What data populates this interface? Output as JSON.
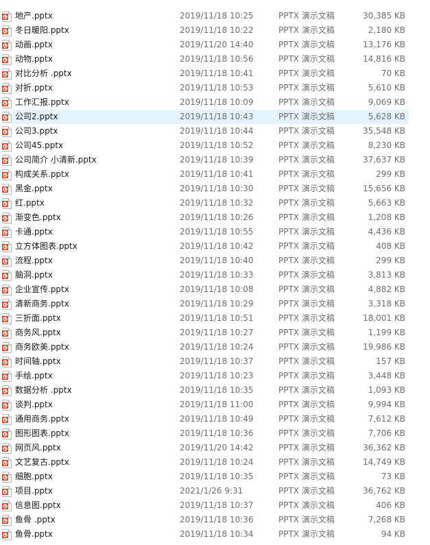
{
  "files": [
    {
      "name": "地产.pptx",
      "date": "2019/11/18 10:25",
      "type": "PPTX 演示文稿",
      "size": "30,385 KB",
      "selected": false
    },
    {
      "name": "冬日暖阳.pptx",
      "date": "2019/11/18 10:22",
      "type": "PPTX 演示文稿",
      "size": "2,180 KB",
      "selected": false
    },
    {
      "name": "动画.pptx",
      "date": "2019/11/20 14:40",
      "type": "PPTX 演示文稿",
      "size": "13,176 KB",
      "selected": false
    },
    {
      "name": "动物.pptx",
      "date": "2019/11/18 10:56",
      "type": "PPTX 演示文稿",
      "size": "14,816 KB",
      "selected": false
    },
    {
      "name": "对比分析 .pptx",
      "date": "2019/11/18 10:41",
      "type": "PPTX 演示文稿",
      "size": "70 KB",
      "selected": false
    },
    {
      "name": "对折.pptx",
      "date": "2019/11/18 10:53",
      "type": "PPTX 演示文稿",
      "size": "5,610 KB",
      "selected": false
    },
    {
      "name": "工作汇报.pptx",
      "date": "2019/11/18 10:09",
      "type": "PPTX 演示文稿",
      "size": "9,069 KB",
      "selected": false
    },
    {
      "name": "公司2.pptx",
      "date": "2019/11/18 10:43",
      "type": "PPTX 演示文稿",
      "size": "5,628 KB",
      "selected": true
    },
    {
      "name": "公司3.pptx",
      "date": "2019/11/18 10:44",
      "type": "PPTX 演示文稿",
      "size": "35,548 KB",
      "selected": false
    },
    {
      "name": "公司45.pptx",
      "date": "2019/11/18 10:52",
      "type": "PPTX 演示文稿",
      "size": "8,230 KB",
      "selected": false
    },
    {
      "name": "公司简介 小清新.pptx",
      "date": "2019/11/18 10:39",
      "type": "PPTX 演示文稿",
      "size": "37,637 KB",
      "selected": false
    },
    {
      "name": "构成关系.pptx",
      "date": "2019/11/18 10:41",
      "type": "PPTX 演示文稿",
      "size": "299 KB",
      "selected": false
    },
    {
      "name": "黑金.pptx",
      "date": "2019/11/18 10:30",
      "type": "PPTX 演示文稿",
      "size": "15,656 KB",
      "selected": false
    },
    {
      "name": "红.pptx",
      "date": "2019/11/18 10:32",
      "type": "PPTX 演示文稿",
      "size": "5,663 KB",
      "selected": false
    },
    {
      "name": "渐变色.pptx",
      "date": "2019/11/18 10:26",
      "type": "PPTX 演示文稿",
      "size": "1,208 KB",
      "selected": false
    },
    {
      "name": "卡通.pptx",
      "date": "2019/11/18 10:55",
      "type": "PPTX 演示文稿",
      "size": "4,436 KB",
      "selected": false
    },
    {
      "name": "立方体图表.pptx",
      "date": "2019/11/18 10:42",
      "type": "PPTX 演示文稿",
      "size": "408 KB",
      "selected": false
    },
    {
      "name": "流程.pptx",
      "date": "2019/11/18 10:40",
      "type": "PPTX 演示文稿",
      "size": "299 KB",
      "selected": false
    },
    {
      "name": "脑洞.pptx",
      "date": "2019/11/18 10:33",
      "type": "PPTX 演示文稿",
      "size": "3,813 KB",
      "selected": false
    },
    {
      "name": "企业宣传.pptx",
      "date": "2019/11/18 10:08",
      "type": "PPTX 演示文稿",
      "size": "4,882 KB",
      "selected": false
    },
    {
      "name": "清新商务.pptx",
      "date": "2019/11/18 10:29",
      "type": "PPTX 演示文稿",
      "size": "3,318 KB",
      "selected": false
    },
    {
      "name": "三折面.pptx",
      "date": "2019/11/18 10:51",
      "type": "PPTX 演示文稿",
      "size": "18,001 KB",
      "selected": false
    },
    {
      "name": "商务风.pptx",
      "date": "2019/11/18 10:27",
      "type": "PPTX 演示文稿",
      "size": "1,199 KB",
      "selected": false
    },
    {
      "name": "商务欧美.pptx",
      "date": "2019/11/18 10:24",
      "type": "PPTX 演示文稿",
      "size": "19,986 KB",
      "selected": false
    },
    {
      "name": "时间轴.pptx",
      "date": "2019/11/18 10:37",
      "type": "PPTX 演示文稿",
      "size": "157 KB",
      "selected": false
    },
    {
      "name": "手绘.pptx",
      "date": "2019/11/18 10:23",
      "type": "PPTX 演示文稿",
      "size": "3,448 KB",
      "selected": false
    },
    {
      "name": "数据分析 .pptx",
      "date": "2019/11/18 10:35",
      "type": "PPTX 演示文稿",
      "size": "1,093 KB",
      "selected": false
    },
    {
      "name": "谈判.pptx",
      "date": "2019/11/18 11:00",
      "type": "PPTX 演示文稿",
      "size": "9,994 KB",
      "selected": false
    },
    {
      "name": "通用商务.pptx",
      "date": "2019/11/18 10:49",
      "type": "PPTX 演示文稿",
      "size": "7,612 KB",
      "selected": false
    },
    {
      "name": "图形图表.pptx",
      "date": "2019/11/18 10:36",
      "type": "PPTX 演示文稿",
      "size": "7,706 KB",
      "selected": false
    },
    {
      "name": "网页风.pptx",
      "date": "2019/11/20 14:42",
      "type": "PPTX 演示文稿",
      "size": "36,362 KB",
      "selected": false
    },
    {
      "name": "文艺复古.pptx",
      "date": "2019/11/18 10:24",
      "type": "PPTX 演示文稿",
      "size": "14,749 KB",
      "selected": false
    },
    {
      "name": "细胞.pptx",
      "date": "2019/11/18 10:35",
      "type": "PPTX 演示文稿",
      "size": "73 KB",
      "selected": false
    },
    {
      "name": "项目.pptx",
      "date": "2021/1/26 9:31",
      "type": "PPTX 演示文稿",
      "size": "36,762 KB",
      "selected": false
    },
    {
      "name": "信息图.pptx",
      "date": "2019/11/18 10:37",
      "type": "PPTX 演示文稿",
      "size": "406 KB",
      "selected": false
    },
    {
      "name": "鱼骨 .pptx",
      "date": "2019/11/18 10:36",
      "type": "PPTX 演示文稿",
      "size": "7,268 KB",
      "selected": false
    },
    {
      "name": "鱼骨.pptx",
      "date": "2019/11/18 10:34",
      "type": "PPTX 演示文稿",
      "size": "94 KB",
      "selected": false
    }
  ],
  "icon": {
    "name": "pptx-file-icon",
    "accent": "#d04423"
  }
}
